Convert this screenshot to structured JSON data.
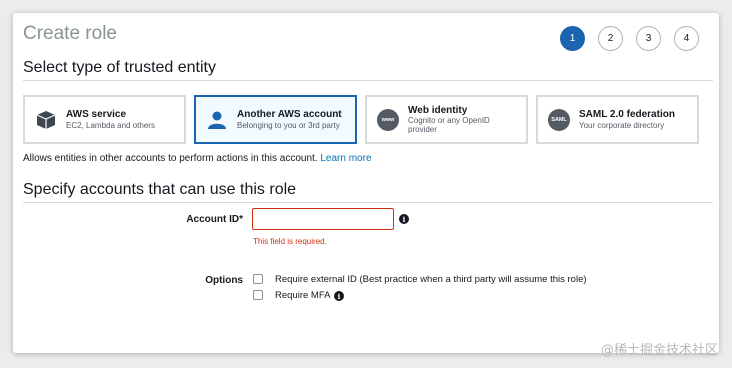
{
  "header": {
    "title": "Create role"
  },
  "steps": [
    "1",
    "2",
    "3",
    "4"
  ],
  "sections": {
    "trusted_entity_title": "Select type of trusted entity",
    "accounts_title": "Specify accounts that can use this role"
  },
  "entities": [
    {
      "name": "AWS service",
      "sub": "EC2, Lambda and others",
      "icon": "cube-icon"
    },
    {
      "name": "Another AWS account",
      "sub": "Belonging to you or 3rd party",
      "icon": "person-icon"
    },
    {
      "name": "Web identity",
      "sub": "Cognito or any OpenID provider",
      "icon": "www-icon",
      "icon_text": "www"
    },
    {
      "name": "SAML 2.0 federation",
      "sub": "Your corporate directory",
      "icon": "saml-icon",
      "icon_text": "SAML"
    }
  ],
  "info": {
    "text": "Allows entities in other accounts to perform actions in this account.",
    "link": "Learn more"
  },
  "form": {
    "account_id_label": "Account ID*",
    "account_id_value": "",
    "account_id_error": "This field is required.",
    "options_label": "Options",
    "option_external_id": "Require external ID (Best practice when a third party will assume this role)",
    "option_mfa": "Require MFA"
  },
  "watermark": "@稀土掘金技术社区",
  "colors": {
    "accent": "#1a64b0",
    "error": "#d13212",
    "link": "#0073bb"
  }
}
